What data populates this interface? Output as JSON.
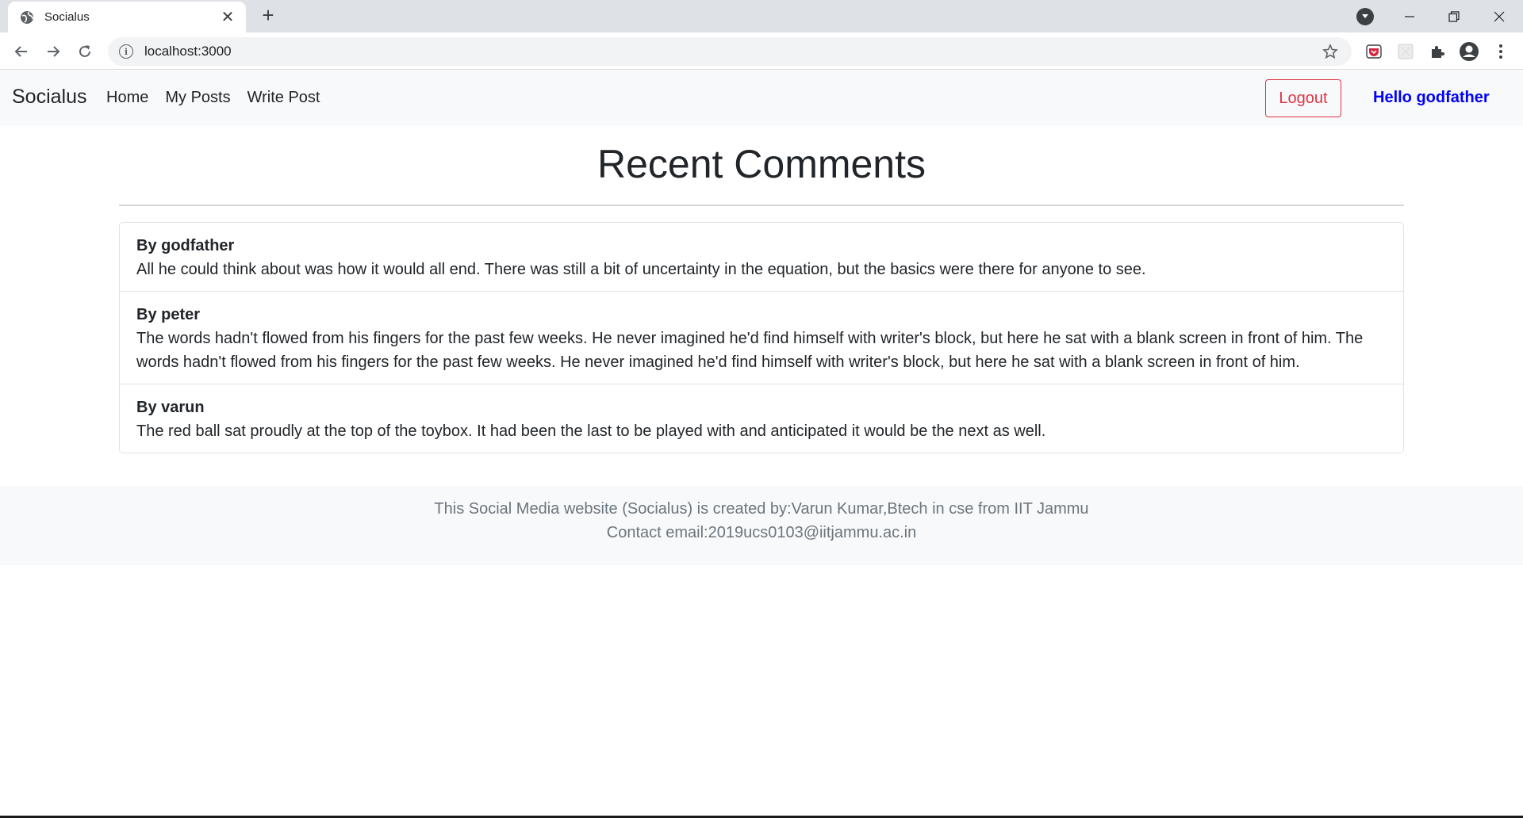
{
  "browser": {
    "tab_title": "Socialus",
    "url": "localhost:3000"
  },
  "navbar": {
    "brand": "Socialus",
    "links": [
      "Home",
      "My Posts",
      "Write Post"
    ],
    "logout_label": "Logout",
    "greeting": "Hello godfather"
  },
  "main": {
    "heading": "Recent Comments",
    "comments": [
      {
        "author": "By godfather",
        "text": "All he could think about was how it would all end. There was still a bit of uncertainty in the equation, but the basics were there for anyone to see."
      },
      {
        "author": "By peter",
        "text": "The words hadn't flowed from his fingers for the past few weeks. He never imagined he'd find himself with writer's block, but here he sat with a blank screen in front of him. The words hadn't flowed from his fingers for the past few weeks. He never imagined he'd find himself with writer's block, but here he sat with a blank screen in front of him."
      },
      {
        "author": "By varun",
        "text": "The red ball sat proudly at the top of the toybox. It had been the last to be played with and anticipated it would be the next as well."
      }
    ]
  },
  "footer": {
    "line1": "This Social Media website (Socialus) is created by:Varun Kumar,Btech in cse from IIT Jammu",
    "line2": "Contact email:2019ucs0103@iitjammu.ac.in"
  },
  "colors": {
    "logout": "#dc3545",
    "greeting": "#0000ff",
    "navbar_bg": "#f8f9fa"
  }
}
